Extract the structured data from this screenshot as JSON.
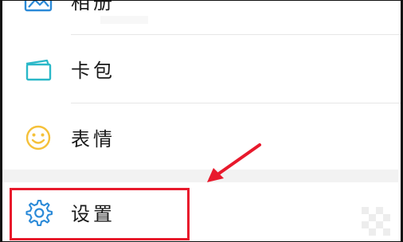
{
  "menu": {
    "items": [
      {
        "label": "相册",
        "icon": "photo-album-icon",
        "color": "#2b8ad8"
      },
      {
        "label": "卡包",
        "icon": "card-wallet-icon",
        "color": "#2ab8c8"
      },
      {
        "label": "表情",
        "icon": "smiley-face-icon",
        "color": "#f5c13a"
      },
      {
        "label": "设置",
        "icon": "gear-icon",
        "color": "#2b8ad8"
      }
    ]
  },
  "annotation": {
    "highlight_color": "#e8192c",
    "arrow_color": "#e8192c"
  }
}
